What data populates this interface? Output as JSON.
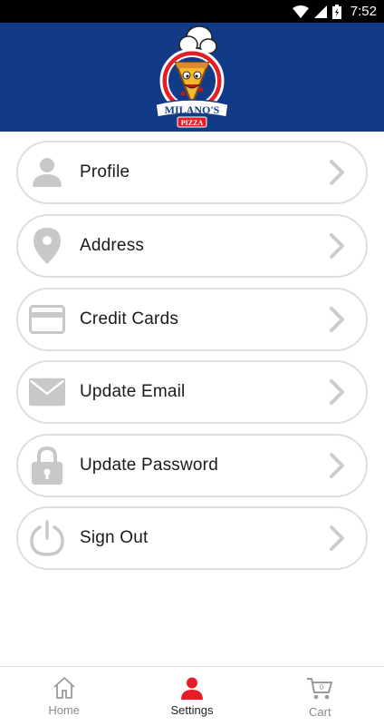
{
  "status_bar": {
    "time": "7:52"
  },
  "header": {
    "logo_text_top": "MILANO'S",
    "logo_text_bottom": "PIZZA"
  },
  "menu": {
    "items": [
      {
        "label": "Profile",
        "icon": "person-icon"
      },
      {
        "label": "Address",
        "icon": "location-pin-icon"
      },
      {
        "label": "Credit Cards",
        "icon": "credit-card-icon"
      },
      {
        "label": "Update Email",
        "icon": "envelope-icon"
      },
      {
        "label": "Update Password",
        "icon": "lock-icon"
      },
      {
        "label": "Sign Out",
        "icon": "power-icon"
      }
    ]
  },
  "bottom_nav": {
    "tabs": [
      {
        "label": "Home",
        "icon": "home-icon"
      },
      {
        "label": "Settings",
        "icon": "person-icon",
        "active": true
      },
      {
        "label": "Cart",
        "icon": "cart-icon",
        "badge": "0"
      }
    ]
  },
  "colors": {
    "header": "#123b87",
    "accent": "#e41e26",
    "icon_gray": "#c8c8c8",
    "border": "#dedede"
  }
}
